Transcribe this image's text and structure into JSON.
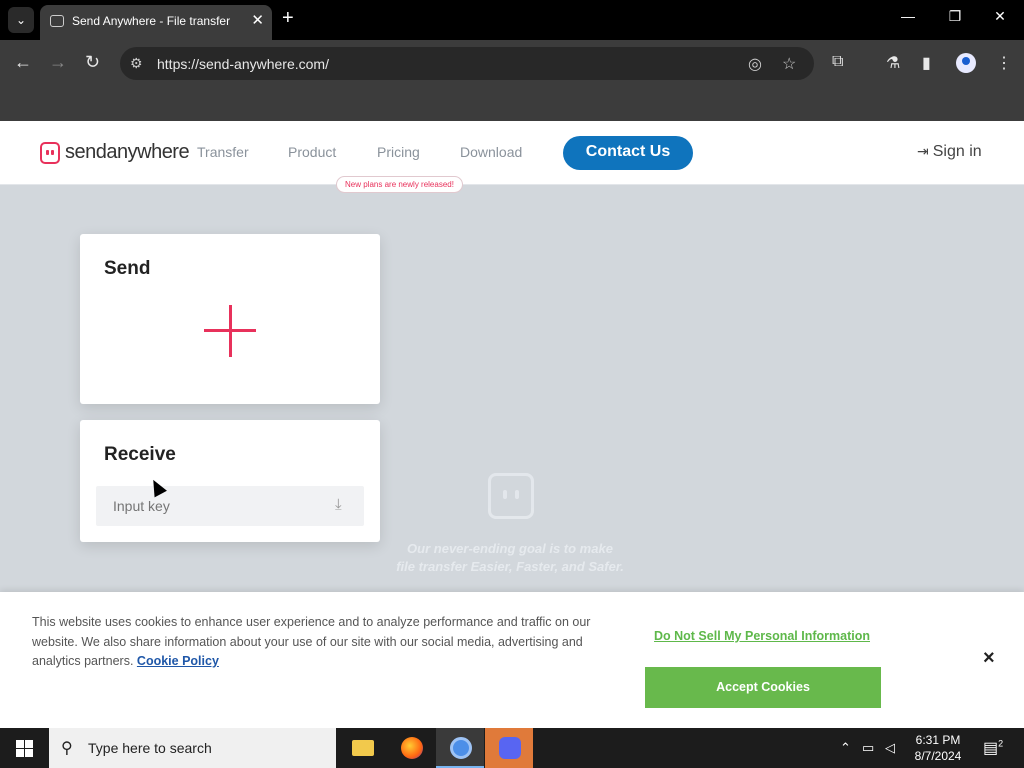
{
  "browser": {
    "tab_title": "Send Anywhere - File transfer",
    "url": "https://send-anywhere.com/",
    "new_tab_label": "+",
    "icons": [
      "tab-search-icon",
      "tab-favicon-icon",
      "close-icon",
      "minimize-icon",
      "restore-icon",
      "back-icon",
      "forward-icon",
      "reload-icon",
      "site-info-icon",
      "eye-off-icon",
      "star-icon",
      "extensions-icon",
      "labs-icon",
      "side-panel-icon",
      "profile-icon",
      "menu-icon"
    ]
  },
  "site": {
    "logo_text_bold": "send",
    "logo_text_rest": "anywhere",
    "nav": [
      "Transfer",
      "Product",
      "Pricing",
      "Download"
    ],
    "pricing_badge": "New plans are newly released!",
    "contact_label": "Contact Us",
    "signin_label": "Sign in",
    "colors": {
      "brand": "#e8315b",
      "contact_button": "#0f74bd",
      "page_bg": "#d2d7dc"
    }
  },
  "send_card": {
    "title": "Send"
  },
  "receive_card": {
    "title": "Receive",
    "input_placeholder": "Input key"
  },
  "hero": {
    "tagline_line1": "Our never-ending goal is to make",
    "tagline_line2": "file transfer Easier, Faster, and Safer."
  },
  "cookie_banner": {
    "text": "This website uses cookies to enhance user experience and to analyze performance and traffic on our website. We also share information about your use of our site with our social media, advertising and analytics partners.",
    "policy_link": "Cookie Policy",
    "do_not_sell": "Do Not Sell My Personal Information",
    "accept_label": "Accept Cookies",
    "close_label": "×",
    "colors": {
      "accept": "#68b94c",
      "link": "#1f57a8"
    }
  },
  "taskbar": {
    "search_placeholder": "Type here to search",
    "time": "6:31 PM",
    "date": "8/7/2024",
    "notification_count": "2"
  }
}
